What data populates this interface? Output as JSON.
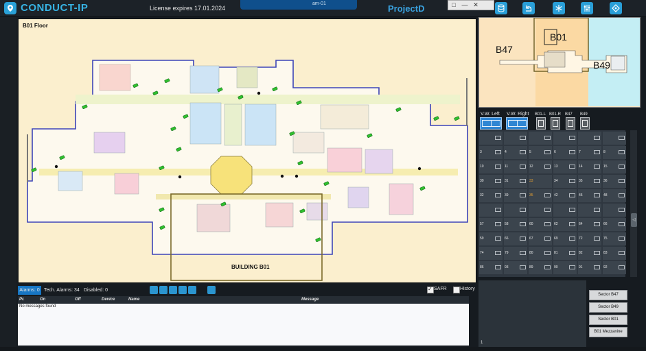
{
  "header": {
    "app_title": "CONDUCT-IP",
    "license": "License expires 17.01.2024",
    "center_tab": "am-01",
    "project": "ProjectD",
    "window_controls": [
      "□",
      "—",
      "✕"
    ],
    "toolbar_icons": [
      "database-icon",
      "undo-icon",
      "snowflake-icon",
      "sliders-icon",
      "settings-icon"
    ]
  },
  "floor": {
    "title": "B01 Floor",
    "building_label": "BUILDING B01"
  },
  "alarm_bar": {
    "alarms_tab": "Alarms: 0",
    "tech_alarms_tab": "Tech. Alarms: 34",
    "disabled_tab": "Disabled: 0",
    "safr_label": "SAFR",
    "safr_checked": true,
    "history_label": "History",
    "history_checked": false,
    "columns": [
      "Pr.",
      "On",
      "Off",
      "Device",
      "Name",
      "Message"
    ],
    "empty_message": "No messages found"
  },
  "minimap": {
    "b47_label": "B47",
    "b01_label": "B01",
    "b49_label": "B49",
    "colors": {
      "b47": "#fbe4bf",
      "b01": "#fbd9a3",
      "b49": "#c4eef4"
    }
  },
  "view_buttons": [
    {
      "label": "V.W. Left"
    },
    {
      "label": "V.W. Right"
    },
    {
      "label": "B01-L"
    },
    {
      "label": "B01-R"
    },
    {
      "label": "B47"
    },
    {
      "label": "B49"
    }
  ],
  "camera_grid": {
    "rows": [
      [
        {
          "n": "",
          "icon": true
        },
        {
          "n": "",
          "icon": true
        },
        {
          "n": "",
          "icon": true
        },
        {
          "n": "",
          "icon": true
        },
        {
          "n": "",
          "icon": true
        },
        {
          "n": "",
          "icon": true
        }
      ],
      [
        {
          "n": "3",
          "icon": true
        },
        {
          "n": "4",
          "icon": true
        },
        {
          "n": "5",
          "icon": true
        },
        {
          "n": "6",
          "icon": true
        },
        {
          "n": "7",
          "icon": true
        },
        {
          "n": "8",
          "icon": true
        }
      ],
      [
        {
          "n": "10",
          "icon": true
        },
        {
          "n": "11",
          "icon": true
        },
        {
          "n": "12",
          "icon": true
        },
        {
          "n": "13",
          "icon": true
        },
        {
          "n": "14",
          "icon": true
        },
        {
          "n": "15",
          "icon": true
        }
      ],
      [
        {
          "n": "30",
          "icon": true
        },
        {
          "n": "31",
          "icon": true
        },
        {
          "n": "33",
          "icon": false,
          "hl": true
        },
        {
          "n": "34",
          "icon": true
        },
        {
          "n": "35",
          "icon": true
        },
        {
          "n": "36",
          "icon": true
        }
      ],
      [
        {
          "n": "32",
          "icon": true
        },
        {
          "n": "39",
          "icon": true
        },
        {
          "n": "35",
          "icon": true,
          "hl": true
        },
        {
          "n": "42",
          "icon": true
        },
        {
          "n": "45",
          "icon": true
        },
        {
          "n": "48",
          "icon": true
        }
      ],
      [
        {
          "n": "",
          "icon": true
        },
        {
          "n": "",
          "icon": true
        },
        {
          "n": "",
          "icon": true
        },
        {
          "n": "",
          "icon": true
        },
        {
          "n": "",
          "icon": true
        },
        {
          "n": "",
          "icon": true
        }
      ],
      [
        {
          "n": "57",
          "icon": true
        },
        {
          "n": "58",
          "icon": true
        },
        {
          "n": "60",
          "icon": true
        },
        {
          "n": "62",
          "icon": true
        },
        {
          "n": "64",
          "icon": true
        },
        {
          "n": "66",
          "icon": true
        }
      ],
      [
        {
          "n": "59",
          "icon": true
        },
        {
          "n": "66",
          "icon": true
        },
        {
          "n": "67",
          "icon": true
        },
        {
          "n": "69",
          "icon": true
        },
        {
          "n": "72",
          "icon": true
        },
        {
          "n": "75",
          "icon": true
        }
      ],
      [
        {
          "n": "74",
          "icon": true
        },
        {
          "n": "79",
          "icon": true
        },
        {
          "n": "80",
          "icon": true
        },
        {
          "n": "81",
          "icon": true
        },
        {
          "n": "82",
          "icon": true
        },
        {
          "n": "83",
          "icon": true
        }
      ],
      [
        {
          "n": "86",
          "icon": true
        },
        {
          "n": "93",
          "icon": true
        },
        {
          "n": "89",
          "icon": true
        },
        {
          "n": "90",
          "icon": true
        },
        {
          "n": "91",
          "icon": true
        },
        {
          "n": "92",
          "icon": true
        }
      ]
    ]
  },
  "bottom_panel": {
    "index": "1"
  },
  "sectors": [
    "Sector B47",
    "Sector B49",
    "Sector B01",
    "B01 Mezzanine"
  ]
}
